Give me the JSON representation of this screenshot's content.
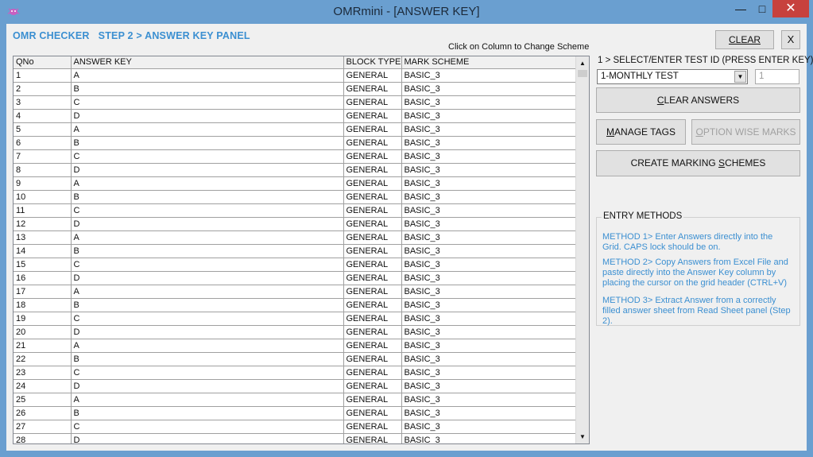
{
  "window": {
    "title": "OMRmini - [ANSWER KEY]",
    "minimize": "—",
    "maximize": "□",
    "close": "✕",
    "app_icon": "bug-icon"
  },
  "header": {
    "title": "OMR CHECKER   STEP 2 > ANSWER KEY PANEL",
    "hint": "Click on Column to Change Scheme",
    "clear_label": "CLEAR",
    "close_label": "X"
  },
  "grid": {
    "columns": [
      "QNo",
      "ANSWER KEY",
      "BLOCK TYPE",
      "MARK SCHEME"
    ],
    "rows": [
      [
        "1",
        "A",
        "GENERAL",
        "BASIC_3"
      ],
      [
        "2",
        "B",
        "GENERAL",
        "BASIC_3"
      ],
      [
        "3",
        "C",
        "GENERAL",
        "BASIC_3"
      ],
      [
        "4",
        "D",
        "GENERAL",
        "BASIC_3"
      ],
      [
        "5",
        "A",
        "GENERAL",
        "BASIC_3"
      ],
      [
        "6",
        "B",
        "GENERAL",
        "BASIC_3"
      ],
      [
        "7",
        "C",
        "GENERAL",
        "BASIC_3"
      ],
      [
        "8",
        "D",
        "GENERAL",
        "BASIC_3"
      ],
      [
        "9",
        "A",
        "GENERAL",
        "BASIC_3"
      ],
      [
        "10",
        "B",
        "GENERAL",
        "BASIC_3"
      ],
      [
        "11",
        "C",
        "GENERAL",
        "BASIC_3"
      ],
      [
        "12",
        "D",
        "GENERAL",
        "BASIC_3"
      ],
      [
        "13",
        "A",
        "GENERAL",
        "BASIC_3"
      ],
      [
        "14",
        "B",
        "GENERAL",
        "BASIC_3"
      ],
      [
        "15",
        "C",
        "GENERAL",
        "BASIC_3"
      ],
      [
        "16",
        "D",
        "GENERAL",
        "BASIC_3"
      ],
      [
        "17",
        "A",
        "GENERAL",
        "BASIC_3"
      ],
      [
        "18",
        "B",
        "GENERAL",
        "BASIC_3"
      ],
      [
        "19",
        "C",
        "GENERAL",
        "BASIC_3"
      ],
      [
        "20",
        "D",
        "GENERAL",
        "BASIC_3"
      ],
      [
        "21",
        "A",
        "GENERAL",
        "BASIC_3"
      ],
      [
        "22",
        "B",
        "GENERAL",
        "BASIC_3"
      ],
      [
        "23",
        "C",
        "GENERAL",
        "BASIC_3"
      ],
      [
        "24",
        "D",
        "GENERAL",
        "BASIC_3"
      ],
      [
        "25",
        "A",
        "GENERAL",
        "BASIC_3"
      ],
      [
        "26",
        "B",
        "GENERAL",
        "BASIC_3"
      ],
      [
        "27",
        "C",
        "GENERAL",
        "BASIC_3"
      ],
      [
        "28",
        "D",
        "GENERAL",
        "BASIC_3"
      ]
    ],
    "scroll_up": "▲",
    "scroll_down": "▼"
  },
  "right": {
    "select_label": "1 > SELECT/ENTER TEST ID (PRESS ENTER KEY)",
    "selected_test": "1-MONTHLY TEST",
    "dropdown_arrow": "▼",
    "test_id_value": "1",
    "clear_answers": "CLEAR ANSWERS",
    "manage_tags": "MANAGE TAGS",
    "option_wise_marks": "OPTION WISE MARKS",
    "create_schemes": "CREATE MARKING SCHEMES"
  },
  "entry_methods": {
    "legend": "ENTRY METHODS",
    "method1": "METHOD 1> Enter Answers directly into the Grid. CAPS lock should be on.",
    "method2": "METHOD 2> Copy Answers from Excel File and paste directly into the Answer Key column by placing the cursor on the grid header (CTRL+V)",
    "method3": "METHOD 3> Extract Answer from a correctly filled answer sheet from Read Sheet panel (Step 2)."
  },
  "colors": {
    "titlebar": "#6a9fd0",
    "accent_text": "#3b8fd1",
    "close_button": "#c7413d"
  }
}
